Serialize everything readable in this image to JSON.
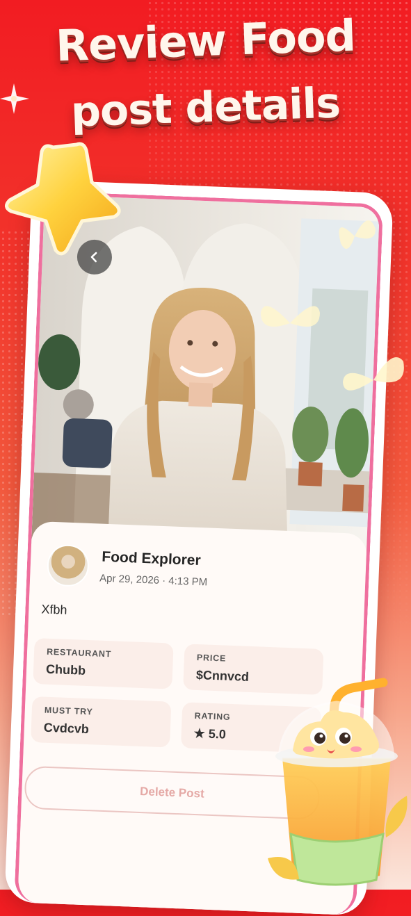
{
  "headline": {
    "line1": "Review Food",
    "line2": "post details"
  },
  "post": {
    "author": "Food Explorer",
    "date": "Apr 29, 2026 · 4:13 PM",
    "caption": "Xfbh"
  },
  "details": {
    "restaurant_label": "RESTAURANT",
    "restaurant_value": "Chubb",
    "price_label": "PRICE",
    "price_value": "$Cnnvcd",
    "must_try_label": "MUST TRY",
    "must_try_value": "Cvdcvb",
    "rating_label": "RATING",
    "rating_value": "★ 5.0"
  },
  "actions": {
    "delete_label": "Delete Post"
  },
  "icons": {
    "back": "chevron-left-icon",
    "star": "star-icon",
    "sparkle": "sparkle-icon"
  },
  "colors": {
    "background_top": "#f21c22",
    "phone_border": "#ef6f9e",
    "card": "#fffaf7",
    "delete_text": "#e5a9a6"
  }
}
